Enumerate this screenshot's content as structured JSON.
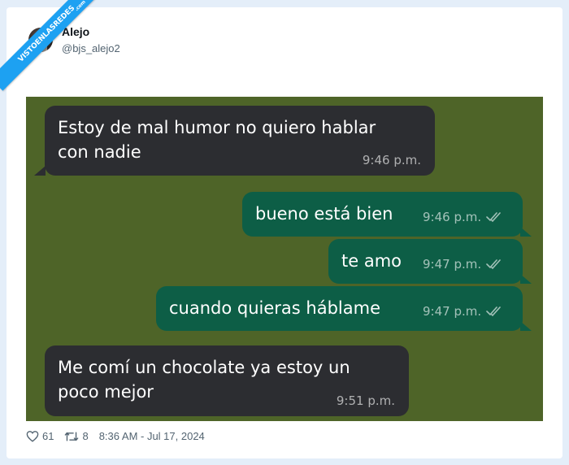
{
  "watermark": {
    "main": "VISTOENLASREDES",
    "sub": ".com"
  },
  "author": {
    "name": "Alejo",
    "handle": "@bjs_alejo2"
  },
  "messages": [
    {
      "dir": "in",
      "text": "Estoy de mal humor no quiero hablar\ncon nadie",
      "time": "9:46 p.m."
    },
    {
      "dir": "out",
      "text": "bueno está bien",
      "time": "9:46 p.m."
    },
    {
      "dir": "out",
      "text": "te amo",
      "time": "9:47 p.m."
    },
    {
      "dir": "out",
      "text": "cuando quieras háblame",
      "time": "9:47 p.m."
    },
    {
      "dir": "in",
      "text": "Me comí un chocolate ya estoy un\npoco mejor",
      "time": "9:51 p.m."
    }
  ],
  "footer": {
    "likes": "61",
    "retweets": "8",
    "timestamp": "8:36 AM - Jul 17, 2024"
  },
  "colors": {
    "chat_background": "#4e6428",
    "incoming_bubble": "#2c2d31",
    "outgoing_bubble": "#0d5e46",
    "watermark_ribbon": "#1da1f2"
  },
  "icons": [
    "heart-icon",
    "retweet-icon",
    "double-check-icon"
  ]
}
